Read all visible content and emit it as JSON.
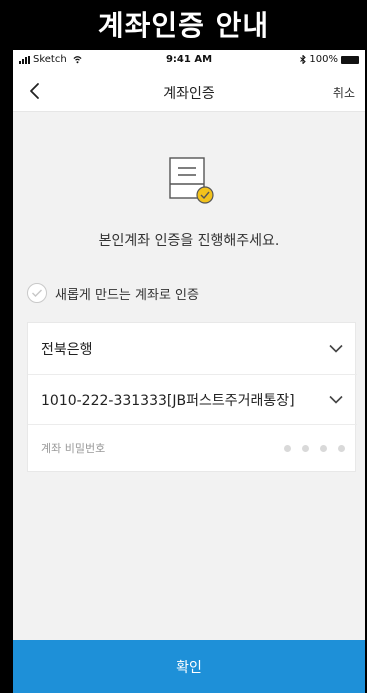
{
  "banner": {
    "title": "계좌인증 안내"
  },
  "status_bar": {
    "carrier": "Sketch",
    "time": "9:41 AM",
    "battery": "100%"
  },
  "nav": {
    "title": "계좌인증",
    "cancel_label": "취소"
  },
  "guide": {
    "message": "본인계좌 인증을 진행해주세요."
  },
  "new_account": {
    "label": "새롭게 만드는 계좌로 인증"
  },
  "form": {
    "bank": "전북은행",
    "account": "1010-222-331333[JB퍼스트주거래통장]",
    "password_label": "계좌 비밀번호",
    "password_length": 4
  },
  "confirm": {
    "label": "확인"
  },
  "colors": {
    "accent": "#1e90d8",
    "check_yellow": "#f2c21b"
  }
}
